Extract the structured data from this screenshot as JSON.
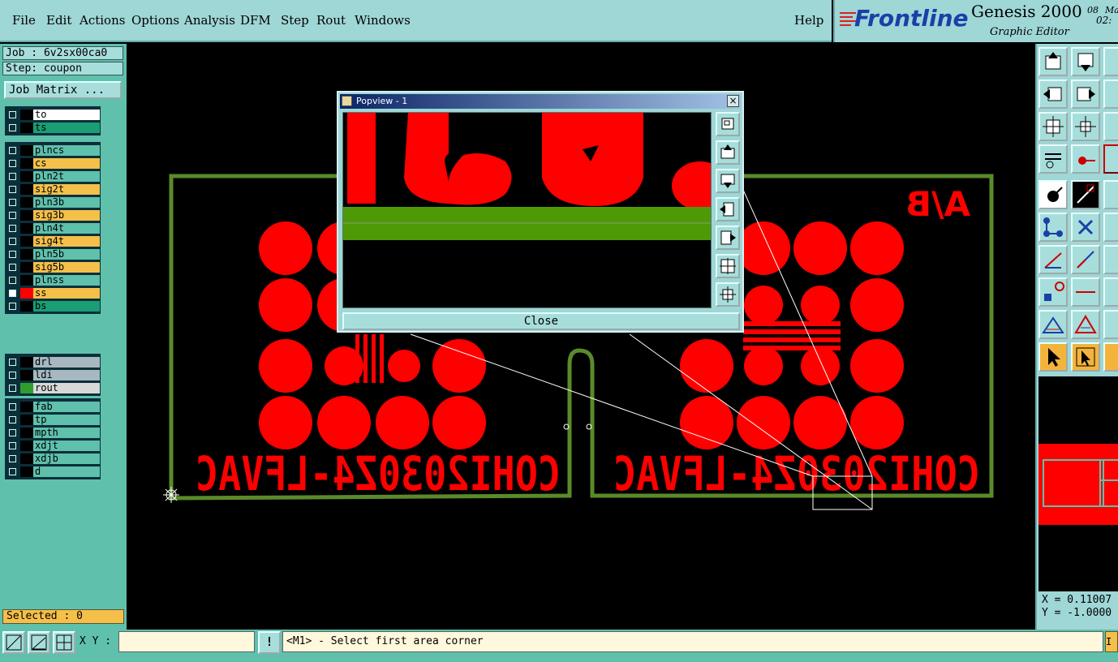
{
  "menubar": {
    "items": [
      "File",
      "Edit",
      "Actions",
      "Options",
      "Analysis",
      "DFM",
      "Step",
      "Rout",
      "Windows"
    ],
    "help": "Help"
  },
  "brand": {
    "logo": "Frontline",
    "product": "Genesis 2000",
    "subtitle": "Graphic Editor",
    "date_fragment": "08",
    "month_fragment": "Ma",
    "time_fragment": "02:"
  },
  "left": {
    "job": "Job : 6v2sx00ca0",
    "step": "Step: coupon",
    "job_matrix": "Job Matrix ...",
    "layer_groups": [
      [
        {
          "name": "to",
          "color": "#ffffff",
          "clr": "#000000"
        },
        {
          "name": "ts",
          "color": "#1b9e74",
          "clr": "#000000"
        }
      ],
      [
        {
          "name": "plncs",
          "color": "#5fc0ac",
          "clr": "#000000"
        },
        {
          "name": "cs",
          "color": "#f4c04a",
          "clr": "#000000"
        },
        {
          "name": "pln2t",
          "color": "#5fc0ac",
          "clr": "#000000"
        },
        {
          "name": "sig2t",
          "color": "#f4c04a",
          "clr": "#000000"
        },
        {
          "name": "pln3b",
          "color": "#5fc0ac",
          "clr": "#000000"
        },
        {
          "name": "sig3b",
          "color": "#f4c04a",
          "clr": "#000000"
        },
        {
          "name": "pln4t",
          "color": "#5fc0ac",
          "clr": "#000000"
        },
        {
          "name": "sig4t",
          "color": "#f4c04a",
          "clr": "#000000"
        },
        {
          "name": "pln5b",
          "color": "#5fc0ac",
          "clr": "#000000"
        },
        {
          "name": "sig5b",
          "color": "#f4c04a",
          "clr": "#000000"
        },
        {
          "name": "plnss",
          "color": "#5fc0ac",
          "clr": "#000000"
        },
        {
          "name": "ss",
          "color": "#f4c04a",
          "clr": "#ff0000",
          "active": true
        },
        {
          "name": "bs",
          "color": "#1b9e74",
          "clr": "#000000"
        }
      ],
      [
        {
          "name": "drl",
          "color": "#a7b8c0",
          "clr": "#000000"
        },
        {
          "name": "ldi",
          "color": "#a7b8c0",
          "clr": "#000000"
        },
        {
          "name": "rout",
          "color": "#d8d8d8",
          "clr": "#2f9e2f"
        }
      ],
      [
        {
          "name": "fab",
          "color": "#5fc0ac",
          "clr": "#000000"
        },
        {
          "name": "tp",
          "color": "#5fc0ac",
          "clr": "#000000"
        },
        {
          "name": "mpth",
          "color": "#5fc0ac",
          "clr": "#000000"
        },
        {
          "name": "xdjt",
          "color": "#5fc0ac",
          "clr": "#000000"
        },
        {
          "name": "xdjb",
          "color": "#5fc0ac",
          "clr": "#000000"
        },
        {
          "name": "d",
          "color": "#5fc0ac",
          "clr": "#000000"
        }
      ]
    ],
    "selected": "Selected : 0"
  },
  "canvas": {
    "text_left": "COHI2030Z4-LFVAC",
    "text_right": "COHI2030Z4-LFVAC",
    "corner_text": "A/B"
  },
  "popup": {
    "title": "Popview - 1",
    "close_x": "×",
    "close": "Close"
  },
  "coords": {
    "x": "X = 0.11007",
    "y": "Y = -1.0000"
  },
  "bottom": {
    "xy_label": "X Y :",
    "xy_value": "",
    "warn": "!",
    "hint": "<M1> - Select first area corner",
    "r": "I"
  },
  "colors": {
    "panel": "#9fd6d6",
    "layer_panel": "#5fc0ac",
    "pad_red": "#ff0000",
    "outline_green": "#5a8a2a"
  }
}
